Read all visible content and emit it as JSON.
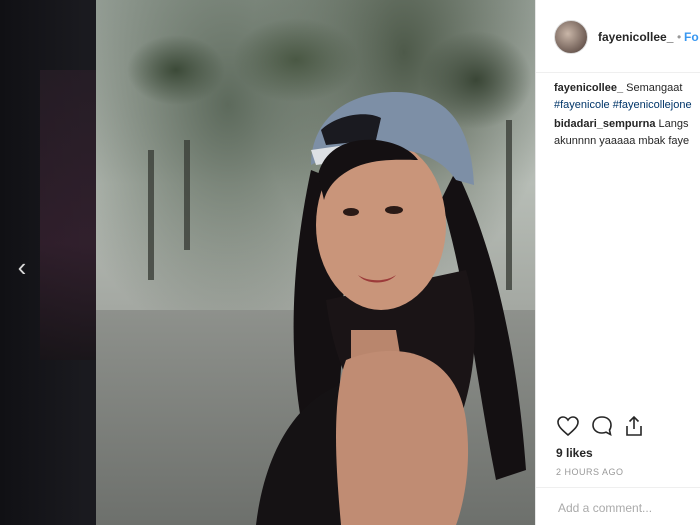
{
  "post": {
    "username": "fayenicollee_",
    "follow_separator": "•",
    "follow_label": "Fo"
  },
  "comments": [
    {
      "user": "fayenicollee_",
      "lines": [
        "Semangaat",
        "#fayenicole #fayenicollejone"
      ]
    },
    {
      "user": "bidadari_sempurna",
      "lines": [
        "Langs",
        "akunnnn yaaaaa mbak faye"
      ]
    }
  ],
  "actions": {
    "like_icon": "heart-icon",
    "comment_icon": "comment-icon",
    "share_icon": "share-icon"
  },
  "likes": "9 likes",
  "timestamp": "2 HOURS AGO",
  "add_comment_placeholder": "Add a comment...",
  "nav": {
    "prev_arrow": "‹"
  },
  "colors": {
    "link_blue": "#3897f0",
    "hashtag": "#003569"
  }
}
